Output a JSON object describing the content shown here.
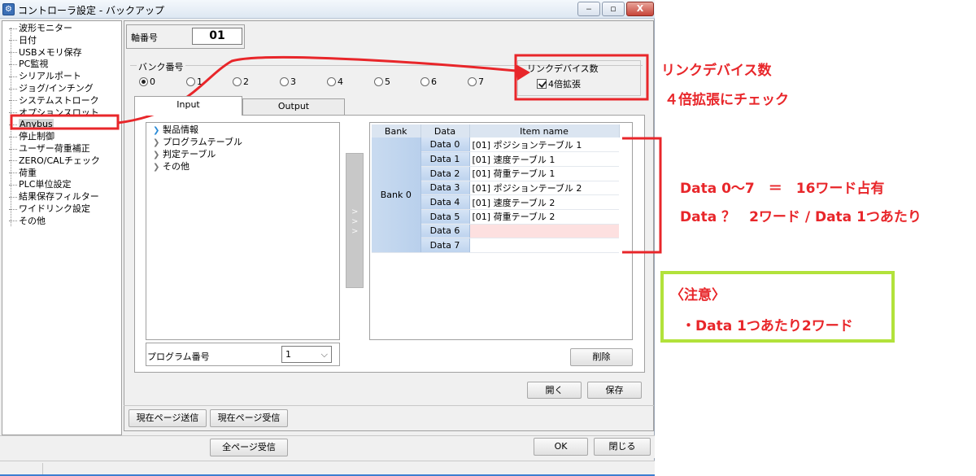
{
  "window": {
    "title": "コントローラ設定 - バックアップ",
    "controls": {
      "minimize": "‒",
      "maximize": "▫",
      "close": "X"
    }
  },
  "sidebar": {
    "items": [
      {
        "label": "波形モニター"
      },
      {
        "label": "日付"
      },
      {
        "label": "USBメモリ保存"
      },
      {
        "label": "PC監視"
      },
      {
        "label": "シリアルポート"
      },
      {
        "label": "ジョグ/インチング"
      },
      {
        "label": "システムストローク"
      },
      {
        "label": "オプションスロット"
      },
      {
        "label": "Anybus",
        "selected": true
      },
      {
        "label": "停止制御"
      },
      {
        "label": "ユーザー荷重補正"
      },
      {
        "label": "ZERO/CALチェック"
      },
      {
        "label": "荷重"
      },
      {
        "label": "PLC単位設定"
      },
      {
        "label": "結果保存フィルター"
      },
      {
        "label": "ワイドリンク設定"
      },
      {
        "label": "その他"
      }
    ]
  },
  "axis": {
    "label": "軸番号",
    "value": "01"
  },
  "bank": {
    "label": "バンク番号",
    "options": [
      "0",
      "1",
      "2",
      "3",
      "4",
      "5",
      "6",
      "7"
    ],
    "selected": "0"
  },
  "link_device": {
    "label": "リンクデバイス数",
    "checkbox_label": "4倍拡張",
    "checked": true
  },
  "tabs": [
    {
      "label": "Input",
      "active": true
    },
    {
      "label": "Output",
      "active": false
    }
  ],
  "product_tree": [
    "製品情報",
    "プログラムテーブル",
    "判定テーブル",
    "その他"
  ],
  "program": {
    "label": "プログラム番号",
    "value": "1"
  },
  "transfer_arrows": "> > >",
  "data_table": {
    "headers": [
      "Bank",
      "Data",
      "Item name"
    ],
    "bank_label": "Bank 0",
    "rows": [
      {
        "data": "Data 0",
        "item": "[01] ポジションテーブル 1"
      },
      {
        "data": "Data 1",
        "item": "[01] 速度テーブル 1"
      },
      {
        "data": "Data 2",
        "item": "[01] 荷重テーブル 1"
      },
      {
        "data": "Data 3",
        "item": "[01] ポジションテーブル 2"
      },
      {
        "data": "Data 4",
        "item": "[01] 速度テーブル 2"
      },
      {
        "data": "Data 5",
        "item": "[01] 荷重テーブル 2"
      },
      {
        "data": "Data 6",
        "item": ""
      },
      {
        "data": "Data 7",
        "item": ""
      }
    ]
  },
  "buttons": {
    "delete": "削除",
    "open": "開く",
    "save": "保存",
    "send_page": "現在ページ送信",
    "receive_page": "現在ページ受信",
    "receive_all": "全ページ受信",
    "ok": "OK",
    "close": "閉じる"
  },
  "annotations": {
    "title": "リンクデバイス数",
    "subtitle": "４倍拡張にチェック",
    "data_line1": "Data 0～7　＝　16ワード占有",
    "data_line2": "Data ？　2ワード / Data 1つあたり",
    "note_title": "〈注意〉",
    "note_body": "・Data 1つあたり2ワード",
    "colors": {
      "red": "#e8262a",
      "green": "#b2e23b"
    }
  }
}
